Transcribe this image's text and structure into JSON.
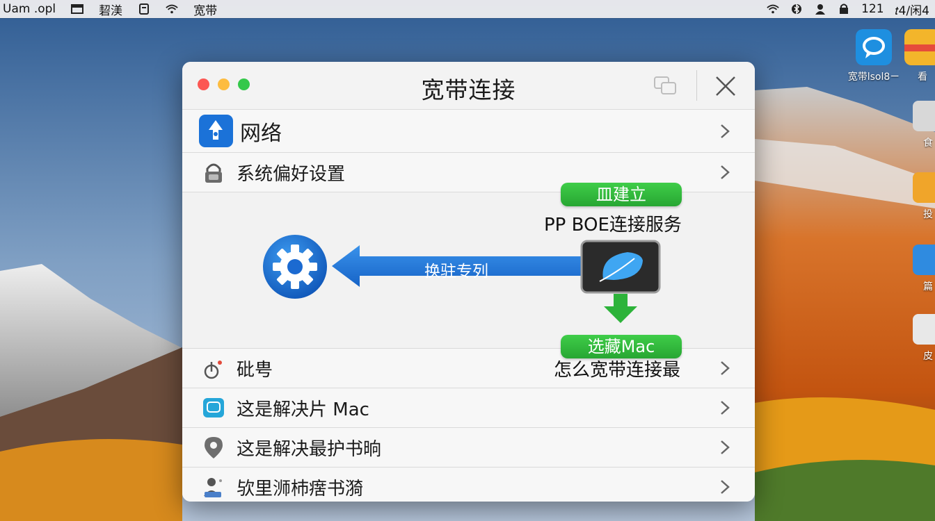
{
  "menubar": {
    "left": [
      "Uam .opl",
      "㗊",
      "䂮渼",
      "㥁",
      "宽带"
    ],
    "right": [
      "121",
      "𝑡4/闲4"
    ]
  },
  "desktop_icons": [
    {
      "label": "宽带lsol8ㄧ",
      "icon": "chat-app-icon"
    },
    {
      "label": "看",
      "icon": "app-icon"
    },
    {
      "label": "食",
      "icon": "app-icon"
    },
    {
      "label": "投",
      "icon": "app-icon"
    },
    {
      "label": "篇",
      "icon": "app-icon"
    },
    {
      "label": "皮",
      "icon": "app-icon"
    }
  ],
  "window": {
    "title": "宽带连接",
    "rows": [
      {
        "label": "网络",
        "icon": "network-icon"
      },
      {
        "label": "系统偏好设置",
        "icon": "lock-icon"
      }
    ],
    "diagram": {
      "top_pill": "建立",
      "top_pill_prefix": "皿",
      "subtitle": "PP BOE连接服务",
      "arrow_label": "换驻专列",
      "bottom_pill": "选藏Mac",
      "bottom_caption": "怎么宽带连接最"
    },
    "lower_rows": [
      {
        "label": "砒甹",
        "icon": "settings-knob-icon"
      },
      {
        "label": "这是解决片 Mac",
        "icon": "chat-icon"
      },
      {
        "label": "这是解决最护书晌",
        "icon": "location-pin-icon"
      },
      {
        "label": "欤里浉杮瘔书漪",
        "icon": "user-group-icon"
      }
    ]
  },
  "colors": {
    "green": "#2fb63b",
    "blue": "#1a6fd6",
    "close": "#fc5753",
    "minimize": "#fdbc40",
    "maximize": "#34c84a"
  }
}
